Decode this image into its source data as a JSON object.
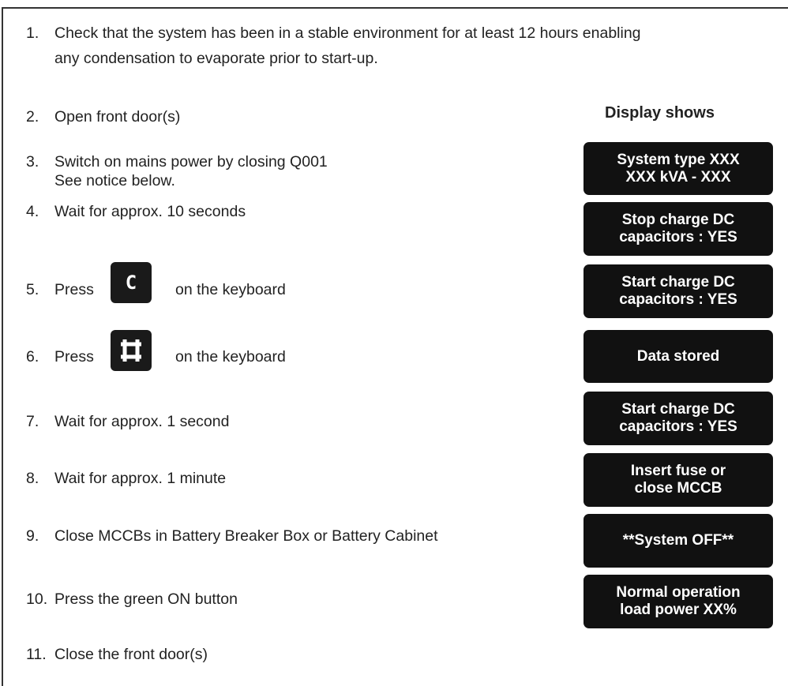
{
  "steps": [
    {
      "num": "1.",
      "lines": [
        "Check that the system has been in a stable environment for at least 12 hours enabling",
        "any condensation to evaporate prior to start-up."
      ]
    },
    {
      "num": "2.",
      "text": "Open front door(s)"
    },
    {
      "num": "3.",
      "lines": [
        "Switch on mains power by closing Q001",
        "See notice below."
      ]
    },
    {
      "num": "4.",
      "text": "Wait for approx. 10 seconds"
    },
    {
      "num": "5.",
      "pre": "Press",
      "post": "on the keyboard",
      "key": "C"
    },
    {
      "num": "6.",
      "pre": "Press",
      "post": "on the keyboard",
      "key_icon": "stop-frame-icon"
    },
    {
      "num": "7.",
      "text": "Wait for approx. 1 second"
    },
    {
      "num": "8.",
      "text": "Wait for approx. 1 minute"
    },
    {
      "num": "9.",
      "text": "Close MCCBs in Battery Breaker Box or Battery Cabinet"
    },
    {
      "num": "10.",
      "text": "Press the green ON button"
    },
    {
      "num": "11.",
      "text": "Close the front door(s)"
    }
  ],
  "display_header": "Display shows",
  "displays": [
    [
      "System type XXX",
      "XXX kVA - XXX"
    ],
    [
      "Stop charge DC",
      "capacitors : YES"
    ],
    [
      "Start charge DC",
      "capacitors : YES"
    ],
    [
      "Data stored"
    ],
    [
      "Start charge DC",
      "capacitors : YES"
    ],
    [
      "Insert fuse or",
      "close MCCB"
    ],
    [
      "**System OFF**"
    ],
    [
      "Normal operation",
      "load power XX%"
    ]
  ],
  "colors": {
    "display_bg": "#111111",
    "display_text": "#ffffff",
    "text": "#222222"
  }
}
